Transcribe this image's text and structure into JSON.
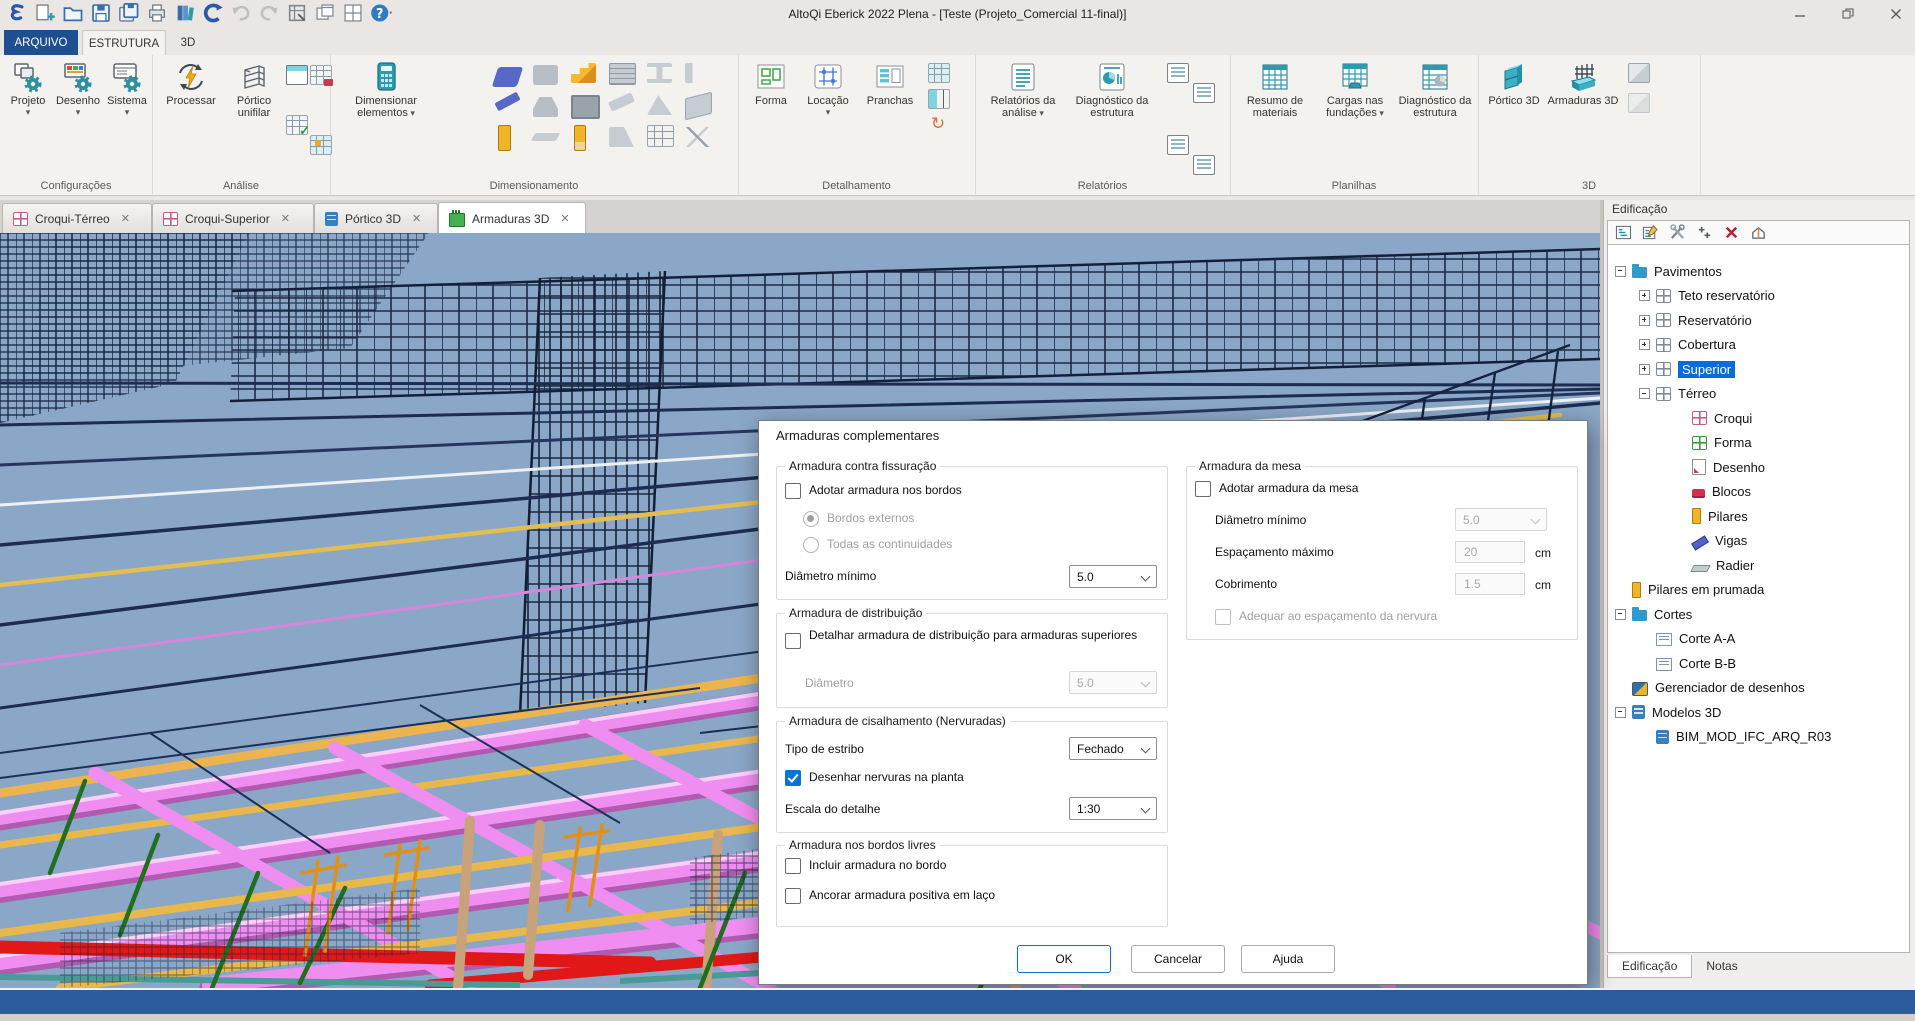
{
  "window": {
    "title": "AltoQi Eberick 2022 Plena - [Teste (Projeto_Comercial 11-final)]"
  },
  "ribbon": {
    "tabs": [
      {
        "label": "ARQUIVO"
      },
      {
        "label": "ESTRUTURA"
      },
      {
        "label": "3D"
      }
    ],
    "groups": [
      {
        "name": "Configurações",
        "buttons": [
          {
            "label": "Projeto"
          },
          {
            "label": "Desenho"
          },
          {
            "label": "Sistema"
          }
        ]
      },
      {
        "name": "Análise",
        "buttons": [
          {
            "label": "Processar"
          },
          {
            "label": "Pórtico unifilar"
          }
        ]
      },
      {
        "name": "Dimensionamento",
        "buttons": [
          {
            "label": "Dimensionar elementos"
          }
        ]
      },
      {
        "name": "Detalhamento",
        "buttons": [
          {
            "label": "Forma"
          },
          {
            "label": "Locação"
          },
          {
            "label": "Pranchas"
          }
        ]
      },
      {
        "name": "Relatórios",
        "buttons": [
          {
            "label": "Relatórios da análise"
          },
          {
            "label": "Diagnóstico da estrutura"
          }
        ]
      },
      {
        "name": "Planilhas",
        "buttons": [
          {
            "label": "Resumo de materiais"
          },
          {
            "label": "Cargas nas fundações"
          },
          {
            "label": "Diagnóstico da estrutura"
          }
        ]
      },
      {
        "name": "3D",
        "buttons": [
          {
            "label": "Pórtico 3D"
          },
          {
            "label": "Armaduras 3D"
          }
        ]
      }
    ]
  },
  "document_tabs": [
    {
      "label": "Croqui-Térreo"
    },
    {
      "label": "Croqui-Superior"
    },
    {
      "label": "Pórtico 3D"
    },
    {
      "label": "Armaduras 3D",
      "active": true
    }
  ],
  "dialog": {
    "title": "Armaduras complementares",
    "fissuracao": {
      "title": "Armadura contra fissuração",
      "adotar_bordos": "Adotar armadura nos bordos",
      "bordos_externos": "Bordos externos",
      "todas_continuidades": "Todas as continuidades",
      "diametro_minimo_label": "Diâmetro mínimo",
      "diametro_minimo_value": "5.0"
    },
    "distribuicao": {
      "title": "Armadura de distribuição",
      "detalhar": "Detalhar armadura de distribuição para armaduras superiores",
      "diametro_label": "Diâmetro",
      "diametro_value": "5.0"
    },
    "cisalhamento": {
      "title": "Armadura de cisalhamento (Nervuradas)",
      "tipo_estribo_label": "Tipo de estribo",
      "tipo_estribo_value": "Fechado",
      "desenhar_nervuras": "Desenhar nervuras na planta",
      "escala_label": "Escala do detalhe",
      "escala_value": "1:30"
    },
    "bordos_livres": {
      "title": "Armadura nos bordos livres",
      "incluir": "Incluir armadura no bordo",
      "ancorar": "Ancorar armadura positiva em laço"
    },
    "mesa": {
      "title": "Armadura da mesa",
      "adotar": "Adotar armadura da mesa",
      "diametro_minimo_label": "Diâmetro mínimo",
      "diametro_minimo_value": "5.0",
      "espacamento_label": "Espaçamento máximo",
      "espacamento_value": "20",
      "espacamento_unit": "cm",
      "cobrimento_label": "Cobrimento",
      "cobrimento_value": "1.5",
      "cobrimento_unit": "cm",
      "adequar": "Adequar ao espaçamento da nervura"
    },
    "buttons": {
      "ok": "OK",
      "cancel": "Cancelar",
      "help": "Ajuda"
    }
  },
  "sidebar": {
    "title": "Edificação",
    "tree": [
      {
        "label": "Pavimentos"
      },
      {
        "label": "Teto reservatório"
      },
      {
        "label": "Reservatório"
      },
      {
        "label": "Cobertura"
      },
      {
        "label": "Superior"
      },
      {
        "label": "Térreo"
      },
      {
        "label": "Croqui"
      },
      {
        "label": "Forma"
      },
      {
        "label": "Desenho"
      },
      {
        "label": "Blocos"
      },
      {
        "label": "Pilares"
      },
      {
        "label": "Vigas"
      },
      {
        "label": "Radier"
      },
      {
        "label": "Pilares em prumada"
      },
      {
        "label": "Cortes"
      },
      {
        "label": "Corte A-A"
      },
      {
        "label": "Corte B-B"
      },
      {
        "label": "Gerenciador de desenhos"
      },
      {
        "label": "Modelos 3D"
      },
      {
        "label": "BIM_MOD_IFC_ARQ_R03"
      }
    ],
    "bottom_tabs": [
      {
        "label": "Edificação"
      },
      {
        "label": "Notas"
      }
    ]
  },
  "colors": {
    "selection": "#0a6cd6",
    "accent_blue": "#1d4f91",
    "status_bar": "#2d5c9e",
    "sky": "#8ba7c7"
  }
}
